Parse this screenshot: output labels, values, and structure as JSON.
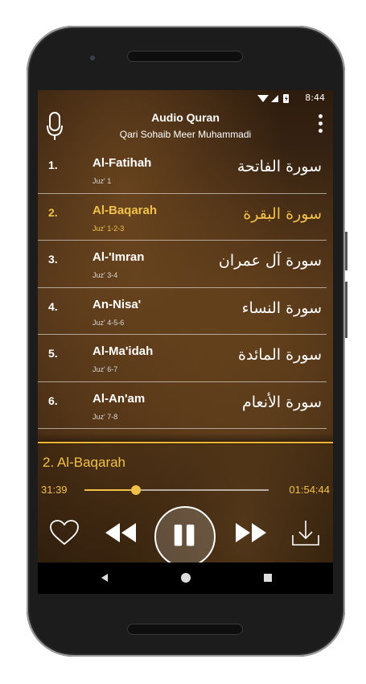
{
  "status_bar": {
    "time": "8:44"
  },
  "header": {
    "title": "Audio Quran",
    "subtitle": "Qari Sohaib Meer Muhammadi"
  },
  "surahs": [
    {
      "number": "1.",
      "name": "Al-Fatihah",
      "juz": "Juz' 1",
      "arabic": "سورة الفاتحة",
      "active": false
    },
    {
      "number": "2.",
      "name": "Al-Baqarah",
      "juz": "Juz' 1-2-3",
      "arabic": "سورة البقرة",
      "active": true
    },
    {
      "number": "3.",
      "name": "Al-'Imran",
      "juz": "Juz' 3-4",
      "arabic": "سورة آل عمران",
      "active": false
    },
    {
      "number": "4.",
      "name": "An-Nisa'",
      "juz": "Juz' 4-5-6",
      "arabic": "سورة النساء",
      "active": false
    },
    {
      "number": "5.",
      "name": "Al-Ma'idah",
      "juz": "Juz' 6-7",
      "arabic": "سورة المائدة",
      "active": false
    },
    {
      "number": "6.",
      "name": "Al-An'am",
      "juz": "Juz' 7-8",
      "arabic": "سورة الأنعام",
      "active": false
    }
  ],
  "player": {
    "now_playing": "2.  Al-Baqarah",
    "current_time": "31:39",
    "total_time": "01:54:44",
    "progress": 0.28
  },
  "icons": {
    "mic": "microphone-icon",
    "menu": "more-vertical-icon",
    "favorite": "heart-icon",
    "previous": "rewind-icon",
    "play_pause": "pause-icon",
    "next": "fast-forward-icon",
    "download": "download-icon"
  },
  "colors": {
    "accent": "#f2c14a",
    "text": "#ffffff"
  }
}
